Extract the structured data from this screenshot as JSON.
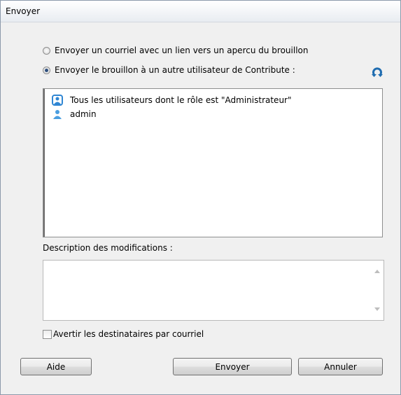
{
  "window": {
    "title": "Envoyer"
  },
  "send_options": {
    "option_email_link": {
      "label": "Envoyer un courriel avec un lien vers un apercu du brouillon",
      "selected": false
    },
    "option_send_user": {
      "label": "Envoyer le brouillon à un autre utilisateur de Contribute :",
      "selected": true
    }
  },
  "refresh": {
    "icon": "refresh-icon",
    "color": "#1f6cb0"
  },
  "users": [
    {
      "name": "Tous les utilisateurs dont le rôle est \"Administrateur\"",
      "icon": "user-group-icon"
    },
    {
      "name": "admin",
      "icon": "user-icon"
    }
  ],
  "description": {
    "label": "Description des modifications :",
    "value": ""
  },
  "notify": {
    "label": "Avertir les destinataires par courriel",
    "checked": false
  },
  "buttons": {
    "help": "Aide",
    "send": "Envoyer",
    "cancel": "Annuler"
  }
}
